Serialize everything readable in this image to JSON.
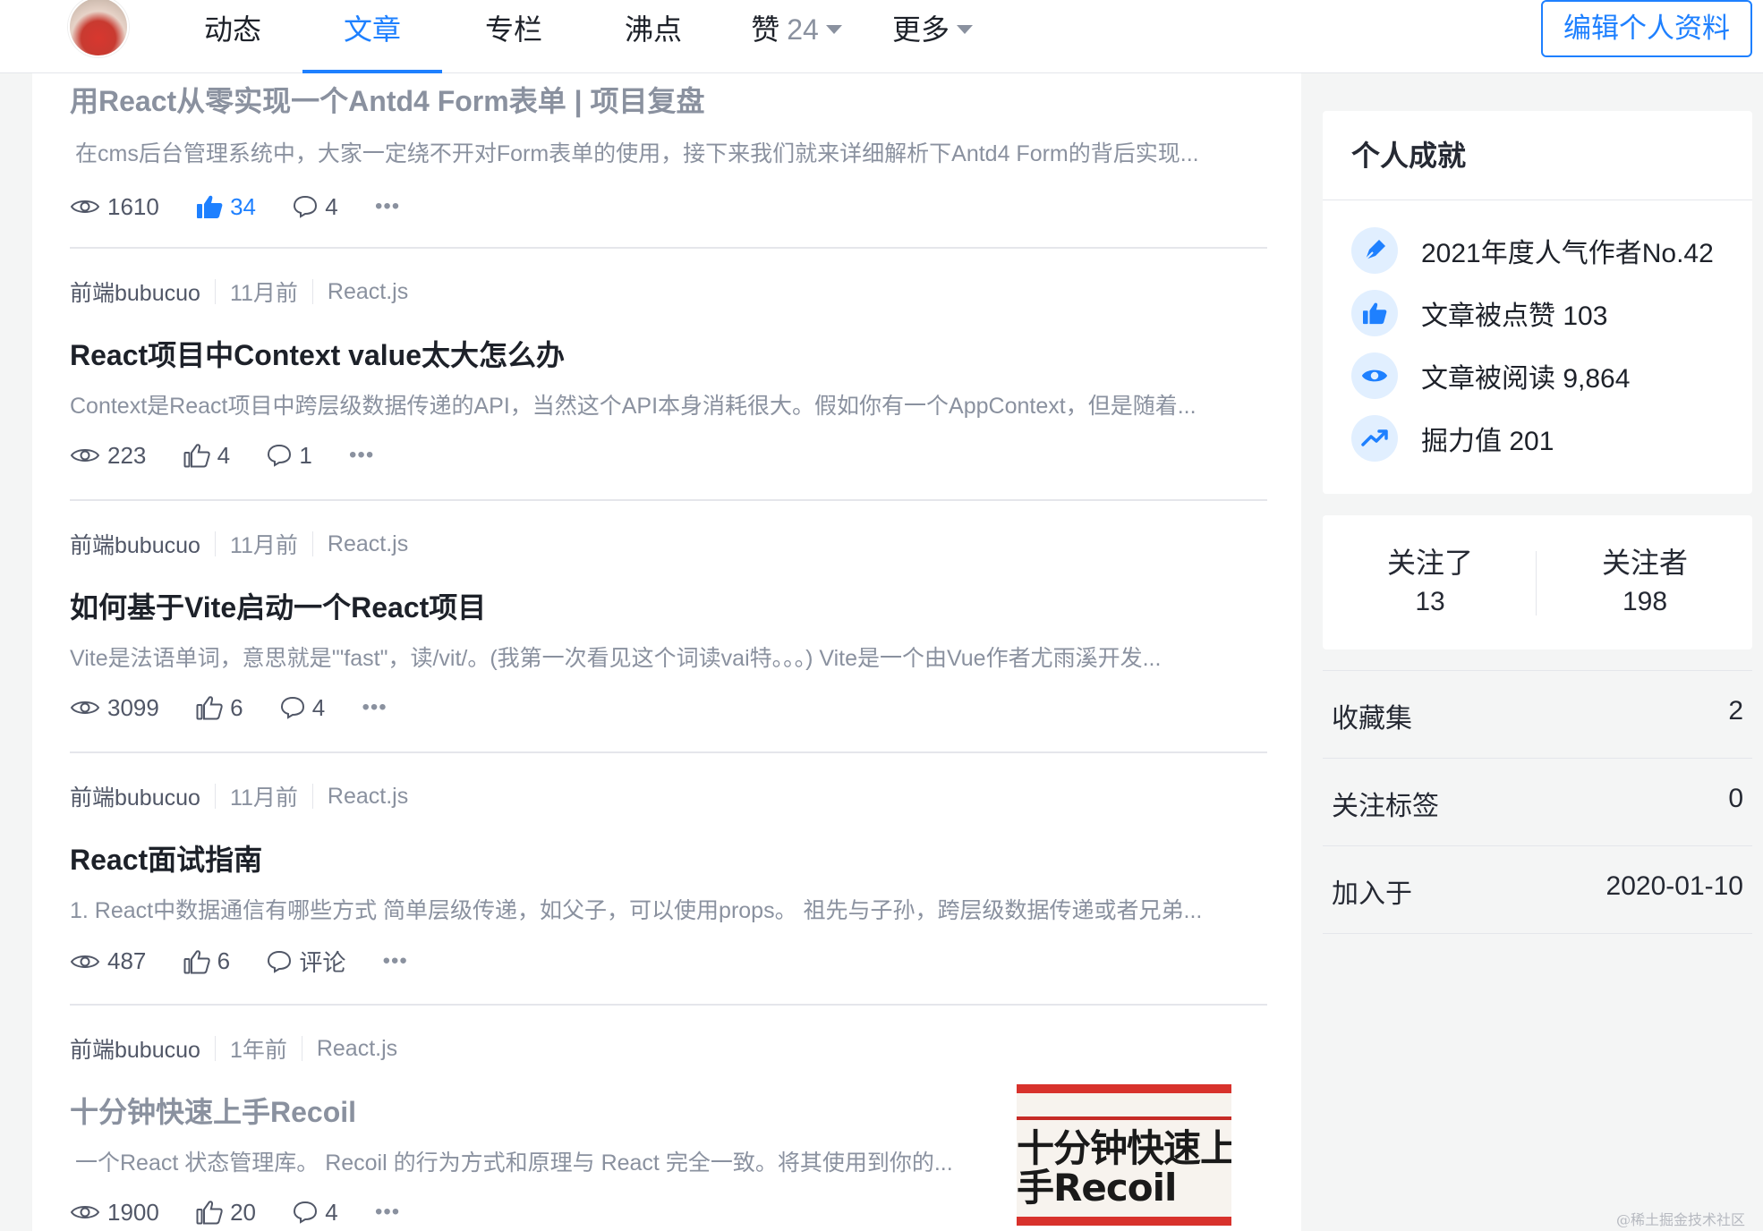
{
  "nav": {
    "tabs": [
      {
        "label": "动态"
      },
      {
        "label": "文章"
      },
      {
        "label": "专栏"
      },
      {
        "label": "沸点"
      },
      {
        "label": "赞",
        "count": "24"
      },
      {
        "label": "更多"
      }
    ],
    "active_tab": "文章",
    "edit_button": "编辑个人资料"
  },
  "articles": [
    {
      "title": "用React从零实现一个Antd4 Form表单 | 项目复盘",
      "abstract": "在cms后台管理系统中，大家一定绕不开对Form表单的使用，接下来我们就来详细解析下Antd4 Form的背后实现...",
      "views": "1610",
      "likes": "34",
      "comments": "4",
      "liked": true
    },
    {
      "author": "前端bubucuo",
      "time": "11月前",
      "tag": "React.js",
      "title": "React项目中Context value太大怎么办",
      "abstract": "Context是React项目中跨层级数据传递的API，当然这个API本身消耗很大。假如你有一个AppContext，但是随着...",
      "views": "223",
      "likes": "4",
      "comments": "1"
    },
    {
      "author": "前端bubucuo",
      "time": "11月前",
      "tag": "React.js",
      "title": "如何基于Vite启动一个React项目",
      "abstract": "Vite是法语单词，意思就是'\"fast\"，读/vit/。(我第一次看见这个词读vai特。。。) Vite是一个由Vue作者尤雨溪开发...",
      "views": "3099",
      "likes": "6",
      "comments": "4"
    },
    {
      "author": "前端bubucuo",
      "time": "11月前",
      "tag": "React.js",
      "title": "React面试指南",
      "abstract": "1. React中数据通信有哪些方式 简单层级传递，如父子，可以使用props。 祖先与子孙，跨层级数据传递或者兄弟...",
      "views": "487",
      "likes": "6",
      "comments": "评论"
    },
    {
      "author": "前端bubucuo",
      "time": "1年前",
      "tag": "React.js",
      "title": "十分钟快速上手Recoil",
      "abstract": "一个React 状态管理库。 Recoil 的行为方式和原理与 React 完全一致。将其使用到你的...",
      "views": "1900",
      "likes": "20",
      "comments": "4",
      "cover_text": "十分钟快速上手Recoil"
    }
  ],
  "achievements": {
    "title": "个人成就",
    "items": [
      {
        "icon": "pen-icon",
        "text": "2021年度人气作者No.42"
      },
      {
        "icon": "thumb-up-icon",
        "text": "文章被点赞 103"
      },
      {
        "icon": "eye-icon",
        "text": "文章被阅读 9,864"
      },
      {
        "icon": "trend-icon",
        "text": "掘力值 201"
      }
    ]
  },
  "follow": {
    "following_label": "关注了",
    "following_count": "13",
    "followers_label": "关注者",
    "followers_count": "198"
  },
  "stats": [
    {
      "key": "收藏集",
      "value": "2"
    },
    {
      "key": "关注标签",
      "value": "0"
    },
    {
      "key": "加入于",
      "value": "2020-01-10"
    }
  ],
  "watermark": "@稀土掘金技术社区",
  "colors": {
    "accent": "#1e80ff",
    "text": "#1d2129",
    "muted": "#8a919f"
  }
}
